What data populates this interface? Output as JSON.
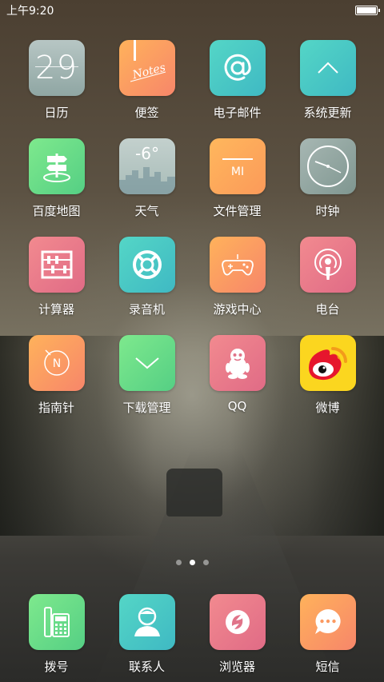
{
  "status_bar": {
    "time": "上午9:20",
    "battery_level": 1.0
  },
  "apps": [
    {
      "label": "日历",
      "icon": "calendar-icon",
      "calendar_day": "29"
    },
    {
      "label": "便签",
      "icon": "notes-icon",
      "icon_text": "Notes"
    },
    {
      "label": "电子邮件",
      "icon": "email-icon"
    },
    {
      "label": "系统更新",
      "icon": "update-icon"
    },
    {
      "label": "百度地图",
      "icon": "map-icon"
    },
    {
      "label": "天气",
      "icon": "weather-icon",
      "temperature": "-6°"
    },
    {
      "label": "文件管理",
      "icon": "file-manager-icon",
      "icon_text": "MI"
    },
    {
      "label": "时钟",
      "icon": "clock-icon"
    },
    {
      "label": "计算器",
      "icon": "calculator-icon"
    },
    {
      "label": "录音机",
      "icon": "recorder-icon"
    },
    {
      "label": "游戏中心",
      "icon": "gamepad-icon"
    },
    {
      "label": "电台",
      "icon": "radio-icon"
    },
    {
      "label": "指南针",
      "icon": "compass-icon",
      "icon_text": "N"
    },
    {
      "label": "下载管理",
      "icon": "download-icon"
    },
    {
      "label": "QQ",
      "icon": "qq-icon"
    },
    {
      "label": "微博",
      "icon": "weibo-icon"
    }
  ],
  "pages": {
    "count": 3,
    "active": 2
  },
  "dock": [
    {
      "label": "拨号",
      "icon": "phone-icon"
    },
    {
      "label": "联系人",
      "icon": "contacts-icon"
    },
    {
      "label": "浏览器",
      "icon": "browser-icon"
    },
    {
      "label": "短信",
      "icon": "messages-icon"
    }
  ],
  "colors": {
    "gray": "#9fb3b1",
    "orange": "#fb9c62",
    "teal": "#4ac8c4",
    "green": "#67dc88",
    "pink": "#e97a8a",
    "weibo_yellow": "#fbd61f"
  }
}
